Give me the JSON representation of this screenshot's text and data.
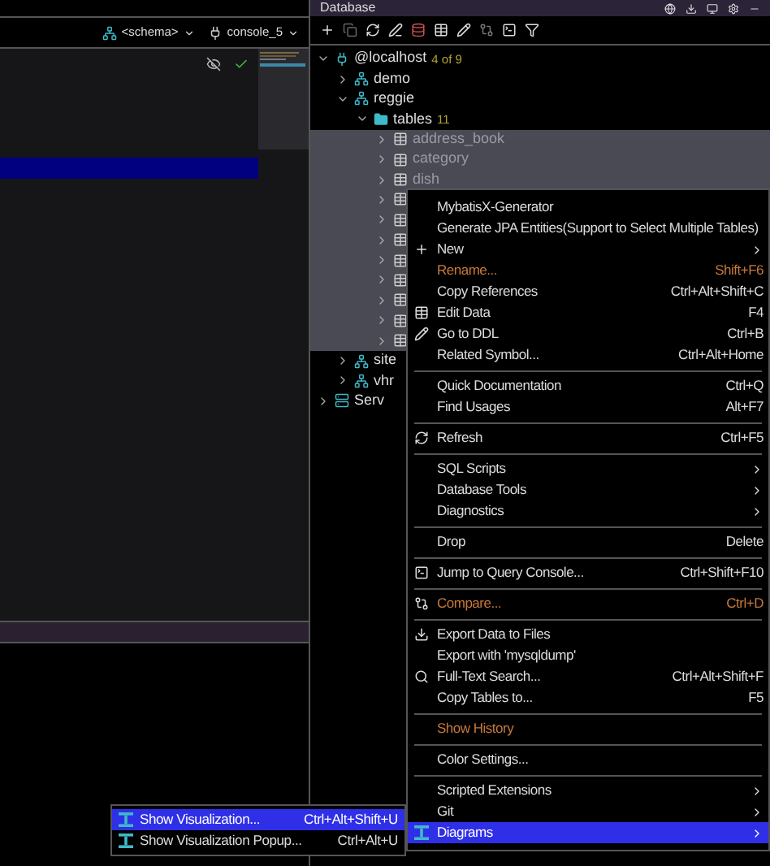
{
  "editor_toolbar": {
    "schema": "<schema>",
    "console": "console_5"
  },
  "editor": {
    "highlighted_line": true,
    "inspection_ok": true
  },
  "database_panel": {
    "title": "Database",
    "tree": [
      {
        "name": "@localhost",
        "badge": "4 of 9",
        "kind": "host",
        "expanded": true,
        "selected": false,
        "children": [
          {
            "name": "demo",
            "kind": "schema",
            "expanded": false,
            "selected": false
          },
          {
            "name": "reggie",
            "kind": "schema",
            "expanded": true,
            "selected": false,
            "children": [
              {
                "name": "tables",
                "badge": "11",
                "kind": "folder",
                "expanded": true,
                "selected": false,
                "children": [
                  {
                    "name": "address_book",
                    "kind": "table",
                    "expanded": false,
                    "selected": true
                  },
                  {
                    "name": "category",
                    "kind": "table",
                    "expanded": false,
                    "selected": true
                  },
                  {
                    "name": "dish",
                    "kind": "table",
                    "expanded": false,
                    "selected": true
                  },
                  {
                    "kind": "table",
                    "expanded": false,
                    "selected": true
                  },
                  {
                    "kind": "table",
                    "expanded": false,
                    "selected": true
                  },
                  {
                    "kind": "table",
                    "expanded": false,
                    "selected": true
                  },
                  {
                    "kind": "table",
                    "expanded": false,
                    "selected": true
                  },
                  {
                    "kind": "table",
                    "expanded": false,
                    "selected": true
                  },
                  {
                    "kind": "table",
                    "expanded": false,
                    "selected": true
                  },
                  {
                    "kind": "table",
                    "expanded": false,
                    "selected": true
                  },
                  {
                    "kind": "table",
                    "expanded": false,
                    "selected": true
                  }
                ]
              }
            ]
          },
          {
            "name": "site",
            "kind": "schema",
            "expanded": false,
            "selected": false
          },
          {
            "name": "vhr",
            "kind": "schema",
            "expanded": false,
            "selected": false
          }
        ]
      },
      {
        "name": "Serv",
        "kind": "server",
        "expanded": false,
        "selected": false
      }
    ]
  },
  "context_menu": [
    {
      "kind": "item",
      "label": "MybatisX-Generator",
      "selected": false
    },
    {
      "kind": "item",
      "label": "Generate JPA Entities(Support to Select Multiple Tables)",
      "selected": false
    },
    {
      "kind": "submenu",
      "label": "New",
      "selected": false
    },
    {
      "kind": "item",
      "label": "Rename...",
      "shortcut": "Shift+F6",
      "color": "#c8793a",
      "selected": false
    },
    {
      "kind": "item",
      "label": "Copy References",
      "shortcut": "Ctrl+Alt+Shift+C",
      "selected": false
    },
    {
      "kind": "item",
      "label": "Edit Data",
      "shortcut": "F4",
      "selected": false
    },
    {
      "kind": "item",
      "label": "Go to DDL",
      "shortcut": "Ctrl+B",
      "selected": false
    },
    {
      "kind": "item",
      "label": "Related Symbol...",
      "shortcut": "Ctrl+Alt+Home",
      "selected": false
    },
    {
      "kind": "separator"
    },
    {
      "kind": "item",
      "label": "Quick Documentation",
      "shortcut": "Ctrl+Q",
      "selected": false
    },
    {
      "kind": "item",
      "label": "Find Usages",
      "shortcut": "Alt+F7",
      "selected": false
    },
    {
      "kind": "separator"
    },
    {
      "kind": "item",
      "label": "Refresh",
      "shortcut": "Ctrl+F5",
      "selected": false
    },
    {
      "kind": "separator"
    },
    {
      "kind": "submenu",
      "label": "SQL Scripts",
      "selected": false
    },
    {
      "kind": "submenu",
      "label": "Database Tools",
      "selected": false
    },
    {
      "kind": "submenu",
      "label": "Diagnostics",
      "selected": false
    },
    {
      "kind": "separator"
    },
    {
      "kind": "item",
      "label": "Drop",
      "shortcut": "Delete",
      "selected": false
    },
    {
      "kind": "separator"
    },
    {
      "kind": "item",
      "label": "Jump to Query Console...",
      "shortcut": "Ctrl+Shift+F10",
      "selected": false
    },
    {
      "kind": "separator"
    },
    {
      "kind": "item",
      "label": "Compare...",
      "shortcut": "Ctrl+D",
      "color": "#c8793a",
      "selected": false
    },
    {
      "kind": "separator"
    },
    {
      "kind": "item",
      "label": "Export Data to Files",
      "selected": false
    },
    {
      "kind": "item",
      "label": "Export with 'mysqldump'",
      "selected": false
    },
    {
      "kind": "item",
      "label": "Full-Text Search...",
      "shortcut": "Ctrl+Alt+Shift+F",
      "selected": false
    },
    {
      "kind": "item",
      "label": "Copy Tables to...",
      "shortcut": "F5",
      "selected": false
    },
    {
      "kind": "separator"
    },
    {
      "kind": "item",
      "label": "Show History",
      "color": "#c8793a",
      "selected": false
    },
    {
      "kind": "separator"
    },
    {
      "kind": "item",
      "label": "Color Settings...",
      "selected": false
    },
    {
      "kind": "separator"
    },
    {
      "kind": "submenu",
      "label": "Scripted Extensions",
      "selected": false
    },
    {
      "kind": "submenu",
      "label": "Git",
      "selected": false
    },
    {
      "kind": "submenu",
      "label": "Diagrams",
      "selected": true
    }
  ],
  "submenu": [
    {
      "label": "Show Visualization...",
      "shortcut": "Ctrl+Alt+Shift+U",
      "selected": true
    },
    {
      "label": "Show Visualization Popup...",
      "shortcut": "Ctrl+Alt+U",
      "selected": false
    }
  ]
}
